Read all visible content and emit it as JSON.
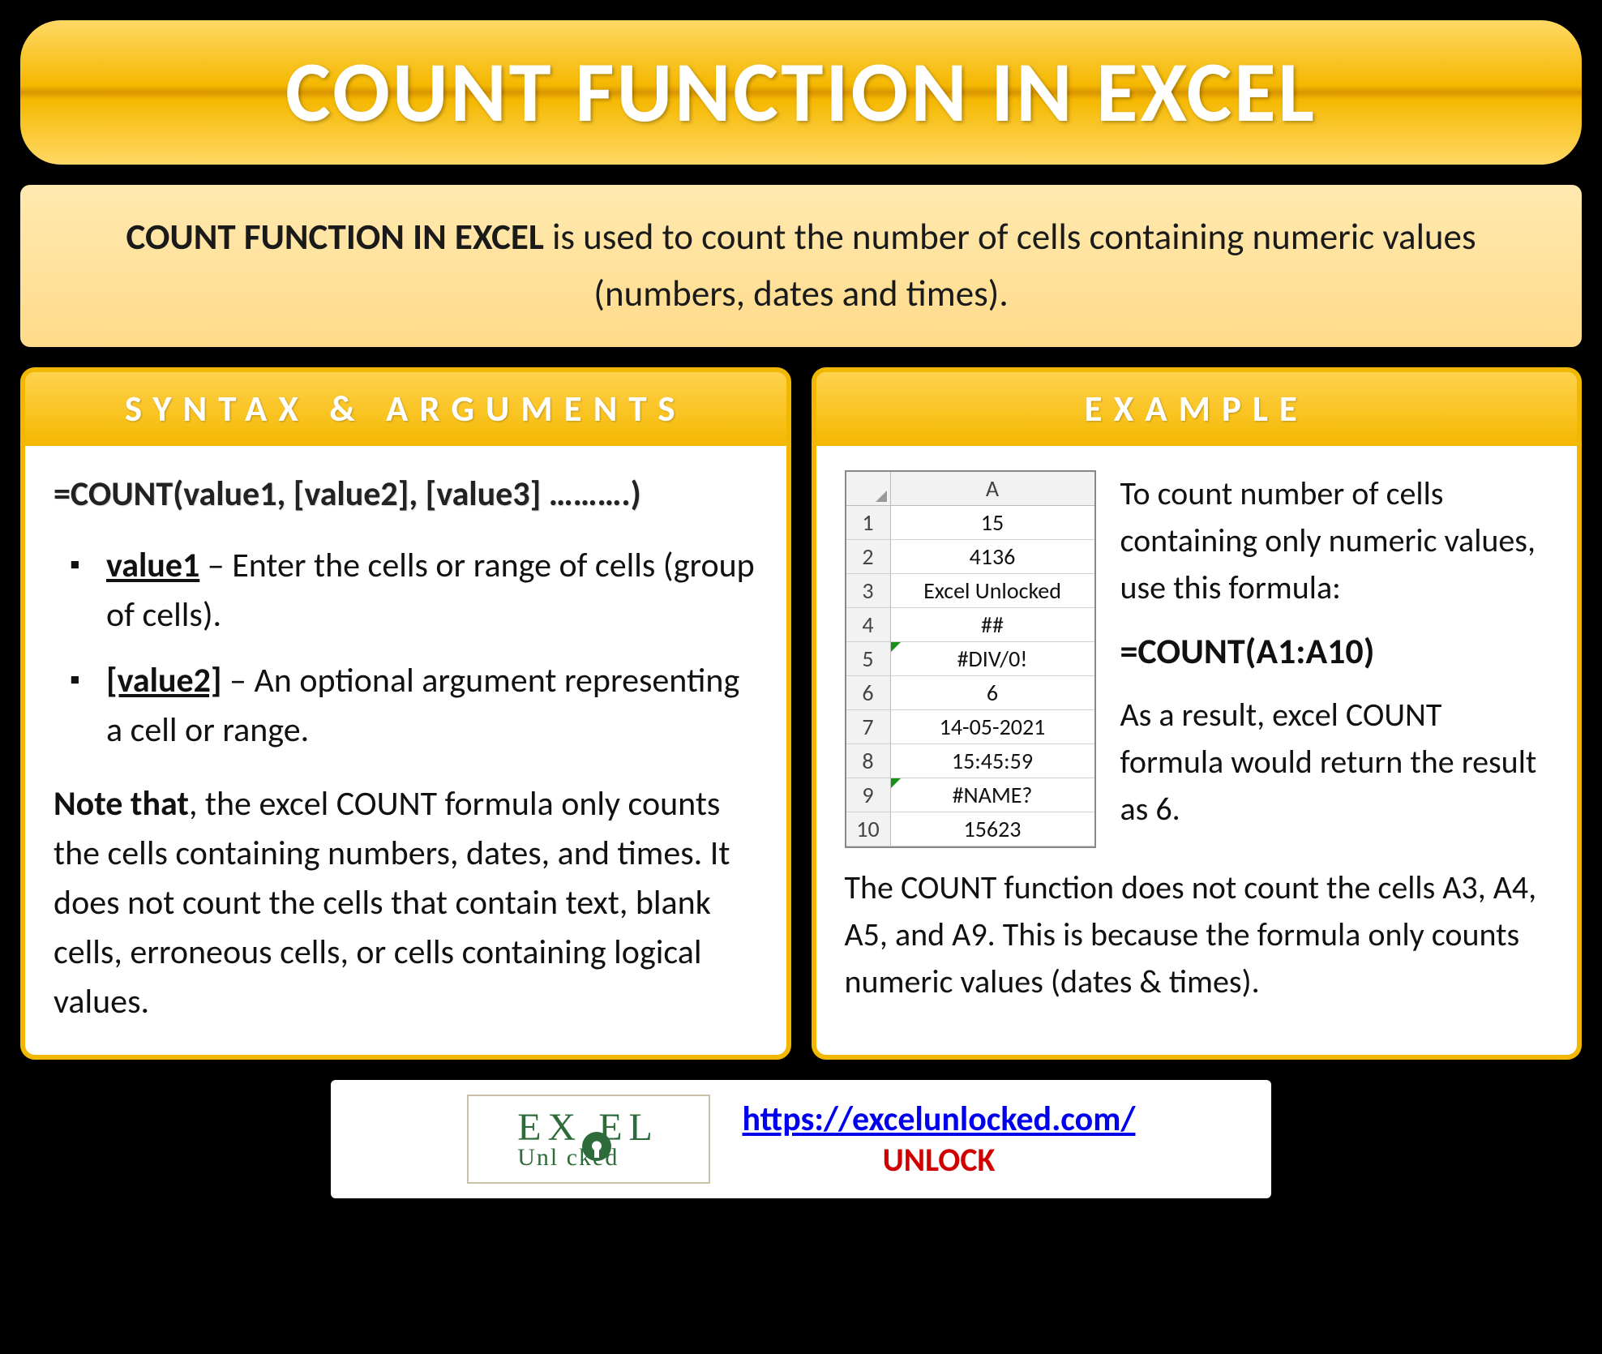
{
  "title": "COUNT FUNCTION IN EXCEL",
  "description": {
    "bold": "COUNT FUNCTION IN EXCEL",
    "rest": " is used to count the number of cells containing numeric values (numbers, dates and times)."
  },
  "syntax": {
    "header": "SYNTAX & ARGUMENTS",
    "formula": "=COUNT(value1, [value2], [value3] ……….)",
    "args": [
      {
        "name": "value1",
        "text": " – Enter the cells or range of cells (group of cells)."
      },
      {
        "name": "[value2]",
        "text": " – An optional argument representing a cell or range."
      }
    ],
    "note_label": "Note that",
    "note_text": ", the excel COUNT formula only counts the cells containing numbers, dates, and times. It does not count the cells that contain text, blank cells, erroneous cells, or cells containing logical values."
  },
  "example": {
    "header": "EXAMPLE",
    "sheet_col": "A",
    "rows": [
      {
        "n": "1",
        "v": "15"
      },
      {
        "n": "2",
        "v": "4136"
      },
      {
        "n": "3",
        "v": "Excel Unlocked"
      },
      {
        "n": "4",
        "v": "##"
      },
      {
        "n": "5",
        "v": "#DIV/0!",
        "tri": true
      },
      {
        "n": "6",
        "v": "6"
      },
      {
        "n": "7",
        "v": "14-05-2021"
      },
      {
        "n": "8",
        "v": "15:45:59"
      },
      {
        "n": "9",
        "v": "#NAME?",
        "tri": true
      },
      {
        "n": "10",
        "v": "15623"
      }
    ],
    "intro": "To count number of cells containing only numeric values, use this formula:",
    "formula": "=COUNT(A1:A10)",
    "result": "As a result, excel COUNT formula would return the result as 6.",
    "note": "The COUNT function does not count the cells A3, A4, A5, and A9. This is because the formula only counts numeric values (dates & times)."
  },
  "footer": {
    "logo_top": "EX   EL",
    "logo_bot": "Unl   cked",
    "url": "https://excelunlocked.com/",
    "unlock": "UNLOCK"
  }
}
